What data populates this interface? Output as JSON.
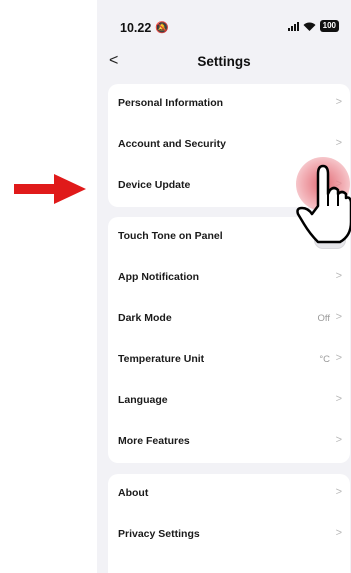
{
  "status_bar": {
    "time": "10.22",
    "battery": "100"
  },
  "nav": {
    "title": "Settings",
    "back_label": "<"
  },
  "groups": [
    {
      "items": [
        {
          "label": "Personal Information"
        },
        {
          "label": "Account and Security"
        },
        {
          "label": "Device Update"
        }
      ]
    },
    {
      "items": [
        {
          "label": "Touch Tone on Panel",
          "control": "toggle"
        },
        {
          "label": "App Notification"
        },
        {
          "label": "Dark Mode",
          "value": "Off"
        },
        {
          "label": "Temperature Unit",
          "value": "°C"
        },
        {
          "label": "Language"
        },
        {
          "label": "More Features"
        }
      ]
    },
    {
      "items": [
        {
          "label": "About"
        },
        {
          "label": "Privacy Settings"
        }
      ]
    }
  ],
  "chevron": ">",
  "colors": {
    "arrow": "#e01a1a",
    "page_bg": "#f2f2f6",
    "press_highlight": "#e0646e"
  },
  "overlay_icons": [
    "red-arrow-icon",
    "pointing-hand-icon"
  ]
}
